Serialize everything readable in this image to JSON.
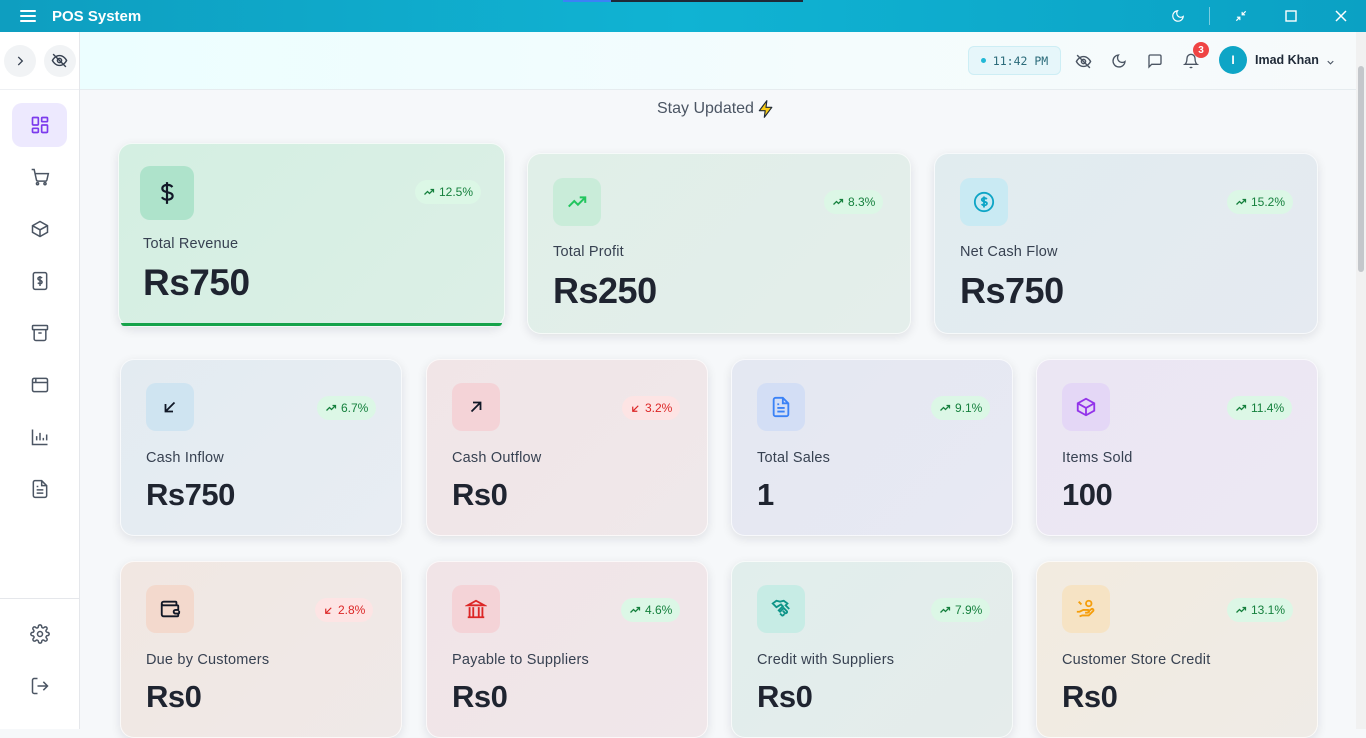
{
  "app": {
    "title": "POS System"
  },
  "header": {
    "time": "11:42 PM",
    "notifications_count": "3",
    "user_initial": "I",
    "user_name": "Imad Khan"
  },
  "main": {
    "heading": "Stay Updated"
  },
  "colors": {
    "accent": "#0ea5c6",
    "active_nav": "#7c3aed",
    "positive": "#16a34a",
    "negative": "#dc2626"
  },
  "sidebar": {
    "items": [
      {
        "name": "dashboard",
        "icon": "grid-icon",
        "active": true
      },
      {
        "name": "sales",
        "icon": "cart-icon"
      },
      {
        "name": "products",
        "icon": "box-icon"
      },
      {
        "name": "finance",
        "icon": "dollar-doc-icon"
      },
      {
        "name": "inventory",
        "icon": "archive-icon"
      },
      {
        "name": "window",
        "icon": "browser-icon"
      },
      {
        "name": "reports",
        "icon": "bar-chart-icon"
      },
      {
        "name": "documents",
        "icon": "document-icon"
      }
    ],
    "bottom": [
      {
        "name": "settings",
        "icon": "gear-icon"
      },
      {
        "name": "logout",
        "icon": "logout-icon"
      }
    ]
  },
  "cards": [
    {
      "label": "Total Revenue",
      "value": "Rs750",
      "change": "12.5%",
      "trend": "up",
      "icon": "dollar-icon"
    },
    {
      "label": "Total Profit",
      "value": "Rs250",
      "change": "8.3%",
      "trend": "up",
      "icon": "trending-up-icon"
    },
    {
      "label": "Net Cash Flow",
      "value": "Rs750",
      "change": "15.2%",
      "trend": "up",
      "icon": "dollar-circle-icon"
    },
    {
      "label": "Cash Inflow",
      "value": "Rs750",
      "change": "6.7%",
      "trend": "up",
      "icon": "arrow-down-left-icon"
    },
    {
      "label": "Cash Outflow",
      "value": "Rs0",
      "change": "3.2%",
      "trend": "down",
      "icon": "arrow-up-right-icon"
    },
    {
      "label": "Total Sales",
      "value": "1",
      "change": "9.1%",
      "trend": "up",
      "icon": "document-icon"
    },
    {
      "label": "Items Sold",
      "value": "100",
      "change": "11.4%",
      "trend": "up",
      "icon": "box-icon"
    },
    {
      "label": "Due by Customers",
      "value": "Rs0",
      "change": "2.8%",
      "trend": "down",
      "icon": "wallet-icon"
    },
    {
      "label": "Payable to Suppliers",
      "value": "Rs0",
      "change": "4.6%",
      "trend": "up",
      "icon": "bank-icon"
    },
    {
      "label": "Credit with Suppliers",
      "value": "Rs0",
      "change": "7.9%",
      "trend": "up",
      "icon": "handshake-icon"
    },
    {
      "label": "Customer Store Credit",
      "value": "Rs0",
      "change": "13.1%",
      "trend": "up",
      "icon": "hand-coins-icon"
    }
  ]
}
